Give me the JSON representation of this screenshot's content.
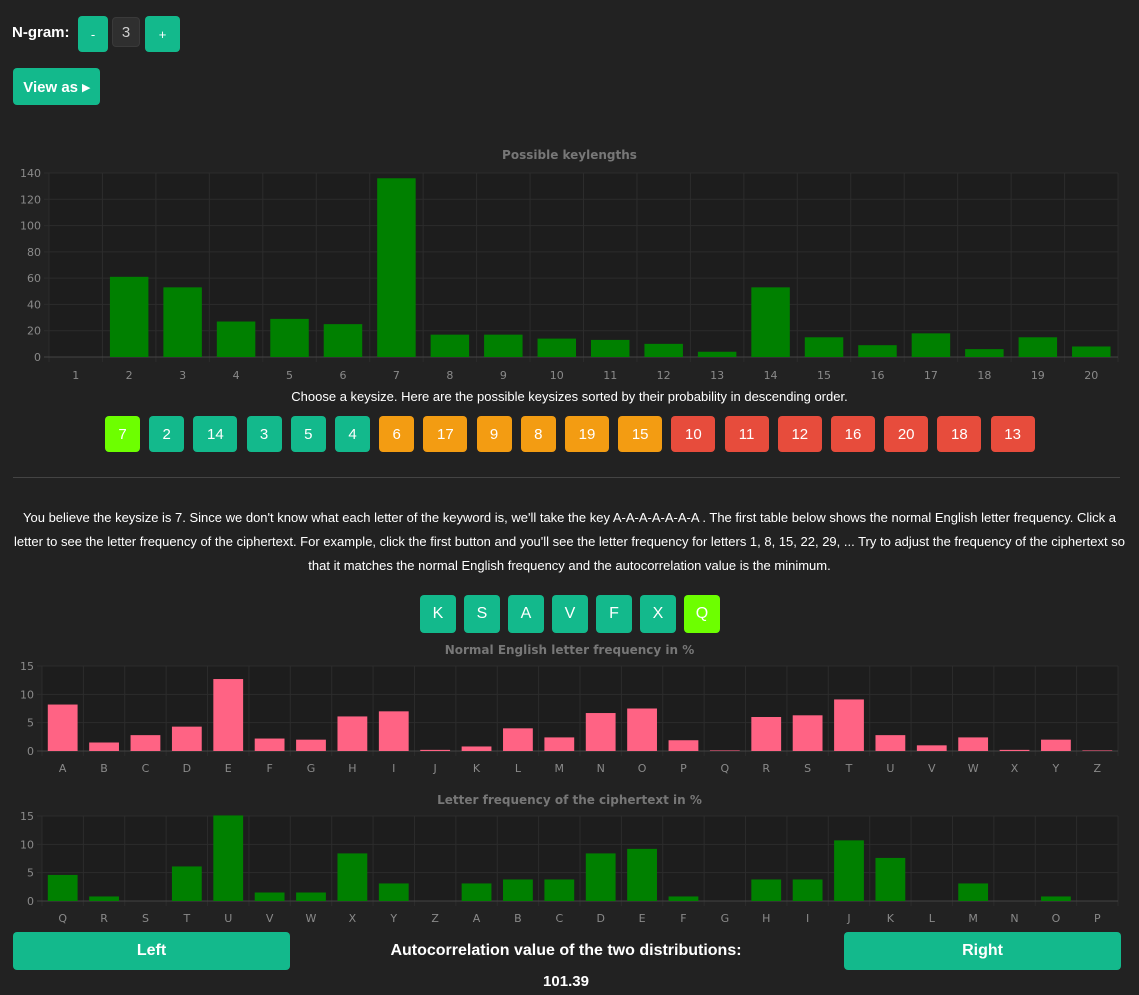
{
  "controls": {
    "ngram_label": "N-gram:",
    "minus_label": "-",
    "ngram_value": "3",
    "plus_label": "+",
    "view_as_label": "View as ▸"
  },
  "keysize": {
    "instruction": "Choose a keysize. Here are the possible keysizes sorted by their probability in descending order.",
    "buttons": [
      {
        "label": "7",
        "status": "selected"
      },
      {
        "label": "2",
        "status": "high"
      },
      {
        "label": "14",
        "status": "high"
      },
      {
        "label": "3",
        "status": "high"
      },
      {
        "label": "5",
        "status": "high"
      },
      {
        "label": "4",
        "status": "high"
      },
      {
        "label": "6",
        "status": "medium"
      },
      {
        "label": "17",
        "status": "medium"
      },
      {
        "label": "9",
        "status": "medium"
      },
      {
        "label": "8",
        "status": "medium"
      },
      {
        "label": "19",
        "status": "medium"
      },
      {
        "label": "15",
        "status": "medium"
      },
      {
        "label": "10",
        "status": "low"
      },
      {
        "label": "11",
        "status": "low"
      },
      {
        "label": "12",
        "status": "low"
      },
      {
        "label": "16",
        "status": "low"
      },
      {
        "label": "20",
        "status": "low"
      },
      {
        "label": "18",
        "status": "low"
      },
      {
        "label": "13",
        "status": "low"
      }
    ]
  },
  "explanation": "You believe the keysize is 7. Since we don't know what each letter of the keyword is, we'll take the key A-A-A-A-A-A-A . The first table below shows the normal English letter frequency. Click a letter to see the letter frequency of the ciphertext. For example, click the first button and you'll see the letter frequency for letters 1, 8, 15, 22, 29, ... Try to adjust the frequency of the ciphertext so that it matches the normal English frequency and the autocorrelation value is the minimum.",
  "key_letters": [
    {
      "label": "K",
      "selected": false
    },
    {
      "label": "S",
      "selected": false
    },
    {
      "label": "A",
      "selected": false
    },
    {
      "label": "V",
      "selected": false
    },
    {
      "label": "F",
      "selected": false
    },
    {
      "label": "X",
      "selected": false
    },
    {
      "label": "Q",
      "selected": true
    }
  ],
  "bottom": {
    "left_label": "Left",
    "right_label": "Right",
    "autocorrelation_label": "Autocorrelation value of the two distributions:",
    "autocorrelation_value": "101.39"
  },
  "colors": {
    "teal": "#13b98c",
    "selected": "#6dff00",
    "orange": "#f39c12",
    "red": "#e74c3c",
    "bar_green": "#008000",
    "bar_pink": "#ff6384"
  },
  "chart_data": [
    {
      "type": "bar",
      "title": "Possible keylengths",
      "categories": [
        "1",
        "2",
        "3",
        "4",
        "5",
        "6",
        "7",
        "8",
        "9",
        "10",
        "11",
        "12",
        "13",
        "14",
        "15",
        "16",
        "17",
        "18",
        "19",
        "20"
      ],
      "values": [
        0,
        61,
        53,
        27,
        29,
        25,
        136,
        17,
        17,
        14,
        13,
        10,
        4,
        53,
        15,
        9,
        18,
        6,
        15,
        8
      ],
      "ylim": [
        0,
        140
      ],
      "yticks": [
        "0",
        "20",
        "40",
        "60",
        "80",
        "100",
        "120",
        "140"
      ],
      "color": "#008000",
      "grid": true
    },
    {
      "type": "bar",
      "title": "Normal English letter frequency in %",
      "categories": [
        "A",
        "B",
        "C",
        "D",
        "E",
        "F",
        "G",
        "H",
        "I",
        "J",
        "K",
        "L",
        "M",
        "N",
        "O",
        "P",
        "Q",
        "R",
        "S",
        "T",
        "U",
        "V",
        "W",
        "X",
        "Y",
        "Z"
      ],
      "values": [
        8.2,
        1.5,
        2.8,
        4.3,
        12.7,
        2.2,
        2.0,
        6.1,
        7.0,
        0.2,
        0.8,
        4.0,
        2.4,
        6.7,
        7.5,
        1.9,
        0.1,
        6.0,
        6.3,
        9.1,
        2.8,
        1.0,
        2.4,
        0.2,
        2.0,
        0.1
      ],
      "ylim": [
        0,
        15
      ],
      "yticks": [
        "0",
        "5",
        "10",
        "15"
      ],
      "color": "#ff6384",
      "grid": true
    },
    {
      "type": "bar",
      "title": "Letter frequency of the ciphertext in %",
      "categories": [
        "Q",
        "R",
        "S",
        "T",
        "U",
        "V",
        "W",
        "X",
        "Y",
        "Z",
        "A",
        "B",
        "C",
        "D",
        "E",
        "F",
        "G",
        "H",
        "I",
        "J",
        "K",
        "L",
        "M",
        "N",
        "O",
        "P"
      ],
      "values": [
        4.6,
        0.8,
        0,
        6.1,
        15.1,
        1.5,
        1.5,
        8.4,
        3.1,
        0,
        3.1,
        3.8,
        3.8,
        8.4,
        9.2,
        0.8,
        0,
        3.8,
        3.8,
        10.7,
        7.6,
        0,
        3.1,
        0,
        0.8,
        0
      ],
      "ylim": [
        0,
        15
      ],
      "yticks": [
        "0",
        "5",
        "10",
        "15"
      ],
      "color": "#008000",
      "grid": true
    }
  ]
}
